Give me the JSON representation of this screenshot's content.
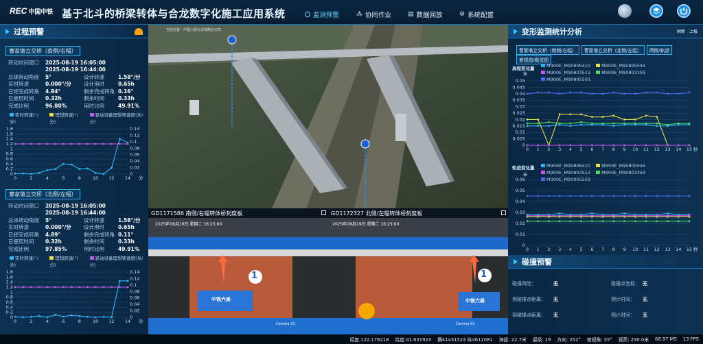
{
  "header": {
    "logo_text": "REC",
    "logo_sub": "中国中铁",
    "title": "基于北斗的桥梁转体与合龙数字化施工应用系统",
    "nav": [
      {
        "label": "监测预警",
        "active": true
      },
      {
        "label": "协同作业"
      },
      {
        "label": "数据回放"
      },
      {
        "label": "系统配置"
      }
    ]
  },
  "left": {
    "title": "过程预警",
    "units": [
      {
        "badge": "曹家墩立交桥（南侧/右幅）",
        "window_label": "转动时间窗口",
        "window_start": "2025-08-19 16:05:00",
        "window_end": "2025-08-19 16:44:00",
        "rows": [
          {
            "l1": "总体转动角度",
            "v1": "5°",
            "l2": "设计转速",
            "v2": "1.58°/分"
          },
          {
            "l1": "实时转速",
            "v1": "0.000°/分",
            "l2": "设计用时",
            "v2": "0.65h"
          },
          {
            "l1": "已经完成转角",
            "v1": "4.84°",
            "l2": "剩余完成转角",
            "v2": "0.16°"
          },
          {
            "l1": "已使用时间",
            "v1": "0.32h",
            "l2": "剩余时间",
            "v2": "0.33h"
          },
          {
            "l1": "完成比例",
            "v1": "96.80%",
            "l2": "用时比例",
            "v2": "49.91%"
          }
        ],
        "legend": [
          "实时转速(°/分)",
          "理想转速(°/分)",
          "驱动设备理想转速度(米/分)"
        ]
      },
      {
        "badge": "曹家墩立交桥（北侧/左幅）",
        "window_label": "转动时间窗口",
        "window_start": "2025-08-19 16:05:00",
        "window_end": "2025-08-19 16:44:00",
        "rows": [
          {
            "l1": "总体转动角度",
            "v1": "5°",
            "l2": "设计转速",
            "v2": "1.58°/分"
          },
          {
            "l1": "实时转速",
            "v1": "0.000°/分",
            "l2": "设计用时",
            "v2": "0.65h"
          },
          {
            "l1": "已经完成转角",
            "v1": "4.89°",
            "l2": "剩余完成转角",
            "v2": "0.11°"
          },
          {
            "l1": "已使用时间",
            "v1": "0.32h",
            "l2": "剩余时间",
            "v2": "0.33h"
          },
          {
            "l1": "完成比例",
            "v1": "97.85%",
            "l2": "用时比例",
            "v2": "49.91%"
          }
        ],
        "legend": [
          "实时转速(°/分)",
          "理想转速(°/分)",
          "驱动设备理想转速度(米/分)"
        ]
      }
    ]
  },
  "right": {
    "title": "变形监测统计分析",
    "tabs": [
      "曹家墩立交桥（南侧/右幅）",
      "曹家墩立交桥（北侧/左幅）",
      "两侧/轨迹",
      "俯视图/概览图"
    ],
    "chart1_label": "高程变化量",
    "chart1_unit": "米",
    "chart2_label": "轨迹变化量",
    "chart2_unit": "米",
    "legend": [
      {
        "name": "M900E_M90806410",
        "color": "#29b6f6"
      },
      {
        "name": "M900E_M90805594",
        "color": "#e8e04a"
      },
      {
        "name": "M900E_M90803513",
        "color": "#c05ce8"
      },
      {
        "name": "M900E_M90803359",
        "color": "#4cd964"
      },
      {
        "name": "M900E_M90805503",
        "color": "#4a6cf0"
      }
    ],
    "top_icons": [
      "refresh-icon",
      "export-icon"
    ],
    "top_labels": [
      "刷新",
      "上报"
    ],
    "collision_title": "碰撞预警",
    "collision": [
      {
        "l1": "碰撞风险：",
        "v1": "无",
        "l2": "碰撞点坐标：",
        "v2": "无"
      },
      {
        "l1": "到碰撞点距离：",
        "v1": "无",
        "l2": "预计时间：",
        "v2": "无"
      },
      {
        "l1": "到碰撞点距离：",
        "v1": "无",
        "l2": "预计时间：",
        "v2": "无"
      }
    ]
  },
  "cams": [
    {
      "title": "GD1171586 南侧/右幅转体桥刻度板",
      "osd": "2025年08月19日 星期二 16:25:00",
      "brand": "中铁六局",
      "num": "1",
      "footer": "Camera 01"
    },
    {
      "title": "GD1172327 北侧/左幅转体桥刻度板",
      "osd": "2025年08月19日 星期二 16:25:00",
      "brand": "中铁六局",
      "num": "1",
      "footer": "Camera 01"
    }
  ],
  "map": {
    "caption": "当前位置：中国六局北京铁路总公司"
  },
  "status": {
    "items": [
      "经度:122.178218",
      "纬度:41.631923",
      "横41431523 纵4611081",
      "海拔: 22.7米",
      "层级: 19",
      "方向: 252°",
      "俯视角: 35°",
      "视高: 230.0米",
      "68.97 MS",
      "13 FPS"
    ]
  },
  "chart_data": [
    {
      "type": "line",
      "title": "",
      "xlabel": "",
      "ylabel": "",
      "x": [
        0,
        1,
        2,
        3,
        4,
        5,
        6,
        7,
        8,
        9,
        10,
        11,
        12,
        13,
        14
      ],
      "series": [
        {
          "name": "实时转速(°/分)",
          "values": [
            0.02,
            0.02,
            0.0,
            0.05,
            0.15,
            0.2,
            0.4,
            0.38,
            0.2,
            0.22,
            0.05,
            0.0,
            0.25,
            1.4,
            1.25
          ]
        },
        {
          "name": "驱动设备理想转速度(米/分)",
          "values": [
            1.2,
            1.2,
            1.2,
            1.2,
            1.2,
            1.2,
            1.2,
            1.2,
            1.2,
            1.2,
            1.2,
            1.2,
            1.2,
            1.2,
            1.2
          ]
        }
      ],
      "ylim": [
        0,
        1.8
      ],
      "y2lim": [
        0,
        0.14
      ],
      "xticks": [
        0,
        2,
        4,
        6,
        8,
        10,
        12,
        14
      ],
      "xunit": "分"
    },
    {
      "type": "line",
      "title": "",
      "xlabel": "",
      "ylabel": "",
      "x": [
        0,
        1,
        2,
        3,
        4,
        5,
        6,
        7,
        8,
        9,
        10,
        11,
        12,
        13,
        14
      ],
      "series": [
        {
          "name": "实时转速(°/分)",
          "values": [
            0.02,
            0.0,
            0.02,
            0.05,
            0.0,
            0.1,
            0.03,
            0.08,
            0.05,
            0.02,
            0.0,
            0.02,
            0.0,
            1.45,
            1.45
          ]
        },
        {
          "name": "驱动设备理想转速度(米/分)",
          "values": [
            1.2,
            1.2,
            1.2,
            1.2,
            1.2,
            1.2,
            1.2,
            1.2,
            1.2,
            1.2,
            1.2,
            1.2,
            1.2,
            1.2,
            1.2
          ]
        }
      ],
      "ylim": [
        0,
        1.8
      ],
      "y2lim": [
        0,
        0.14
      ],
      "xticks": [
        0,
        2,
        4,
        6,
        8,
        10,
        12,
        14
      ],
      "xunit": "分"
    },
    {
      "type": "line",
      "title": "",
      "xlabel": "",
      "ylabel": "",
      "x": [
        0,
        1,
        2,
        3,
        4,
        5,
        6,
        7,
        8,
        9,
        10,
        11,
        12,
        13,
        14,
        15
      ],
      "series": [
        {
          "name": "M900E_M90806410",
          "values": [
            0.015,
            0.015,
            0.015,
            0.016,
            0.015,
            0.016,
            0.016,
            0.016,
            0.015,
            0.016,
            0.016,
            0.016,
            0.015,
            0.015,
            0.016,
            0.016
          ]
        },
        {
          "name": "M900E_M90805594",
          "values": [
            0.02,
            0.02,
            0.0,
            0.024,
            0.024,
            0.024,
            0.022,
            0.022,
            0.023,
            0.02,
            0.02,
            0.023,
            0.022,
            0.0,
            0.0,
            0.0
          ]
        },
        {
          "name": "M900E_M90803513",
          "values": [
            0.0,
            0.0,
            0.0,
            0.0,
            0.0,
            0.0,
            0.0,
            0.0,
            0.0,
            0.0,
            0.0,
            0.0,
            0.0,
            0.0,
            0.0,
            0.0
          ]
        },
        {
          "name": "M900E_M90803359",
          "values": [
            0.017,
            0.017,
            0.018,
            0.017,
            0.017,
            0.018,
            0.017,
            0.017,
            0.017,
            0.017,
            0.017,
            0.017,
            0.017,
            0.016,
            0.017,
            0.017
          ]
        },
        {
          "name": "M900E_M90805503",
          "values": [
            0.04,
            0.041,
            0.041,
            0.04,
            0.041,
            0.041,
            0.04,
            0.04,
            0.041,
            0.04,
            0.04,
            0.041,
            0.041,
            0.04,
            0.04,
            0.041
          ]
        }
      ],
      "ylim": [
        0,
        0.05
      ],
      "xticks": [
        0,
        1,
        2,
        3,
        4,
        5,
        6,
        7,
        8,
        9,
        10,
        11,
        12,
        13,
        14,
        15
      ],
      "xunit": "秒"
    },
    {
      "type": "line",
      "title": "",
      "xlabel": "",
      "ylabel": "",
      "x": [
        0,
        1,
        2,
        3,
        4,
        5,
        6,
        7,
        8,
        9,
        10,
        11,
        12,
        13,
        14,
        15
      ],
      "series": [
        {
          "name": "M900E_M90806410",
          "values": [
            0.028,
            0.028,
            0.028,
            0.029,
            0.028,
            0.028,
            0.029,
            0.028,
            0.028,
            0.029,
            0.028,
            0.028,
            0.028,
            0.029,
            0.028,
            0.028
          ]
        },
        {
          "name": "M900E_M90805594",
          "values": [
            0.026,
            0.026,
            0.026,
            0.026,
            0.026,
            0.026,
            0.026,
            0.026,
            0.026,
            0.026,
            0.026,
            0.026,
            0.026,
            0.026,
            0.026,
            0.026
          ]
        },
        {
          "name": "M900E_M90803513",
          "values": [
            0.027,
            0.027,
            0.027,
            0.027,
            0.027,
            0.027,
            0.027,
            0.027,
            0.027,
            0.027,
            0.027,
            0.027,
            0.027,
            0.027,
            0.027,
            0.027
          ]
        },
        {
          "name": "M900E_M90803359",
          "values": [
            0.022,
            0.022,
            0.022,
            0.022,
            0.022,
            0.022,
            0.022,
            0.022,
            0.022,
            0.022,
            0.022,
            0.022,
            0.022,
            0.022,
            0.022,
            0.022
          ]
        },
        {
          "name": "M900E_M90805503",
          "values": [
            0.045,
            0.045,
            0.045,
            0.045,
            0.045,
            0.045,
            0.045,
            0.045,
            0.045,
            0.045,
            0.045,
            0.045,
            0.045,
            0.045,
            0.045,
            0.045
          ]
        }
      ],
      "ylim": [
        0,
        0.06
      ],
      "xticks": [
        0,
        1,
        2,
        3,
        4,
        5,
        6,
        7,
        8,
        9,
        10,
        11,
        12,
        13,
        14,
        15
      ],
      "xunit": "秒"
    }
  ]
}
